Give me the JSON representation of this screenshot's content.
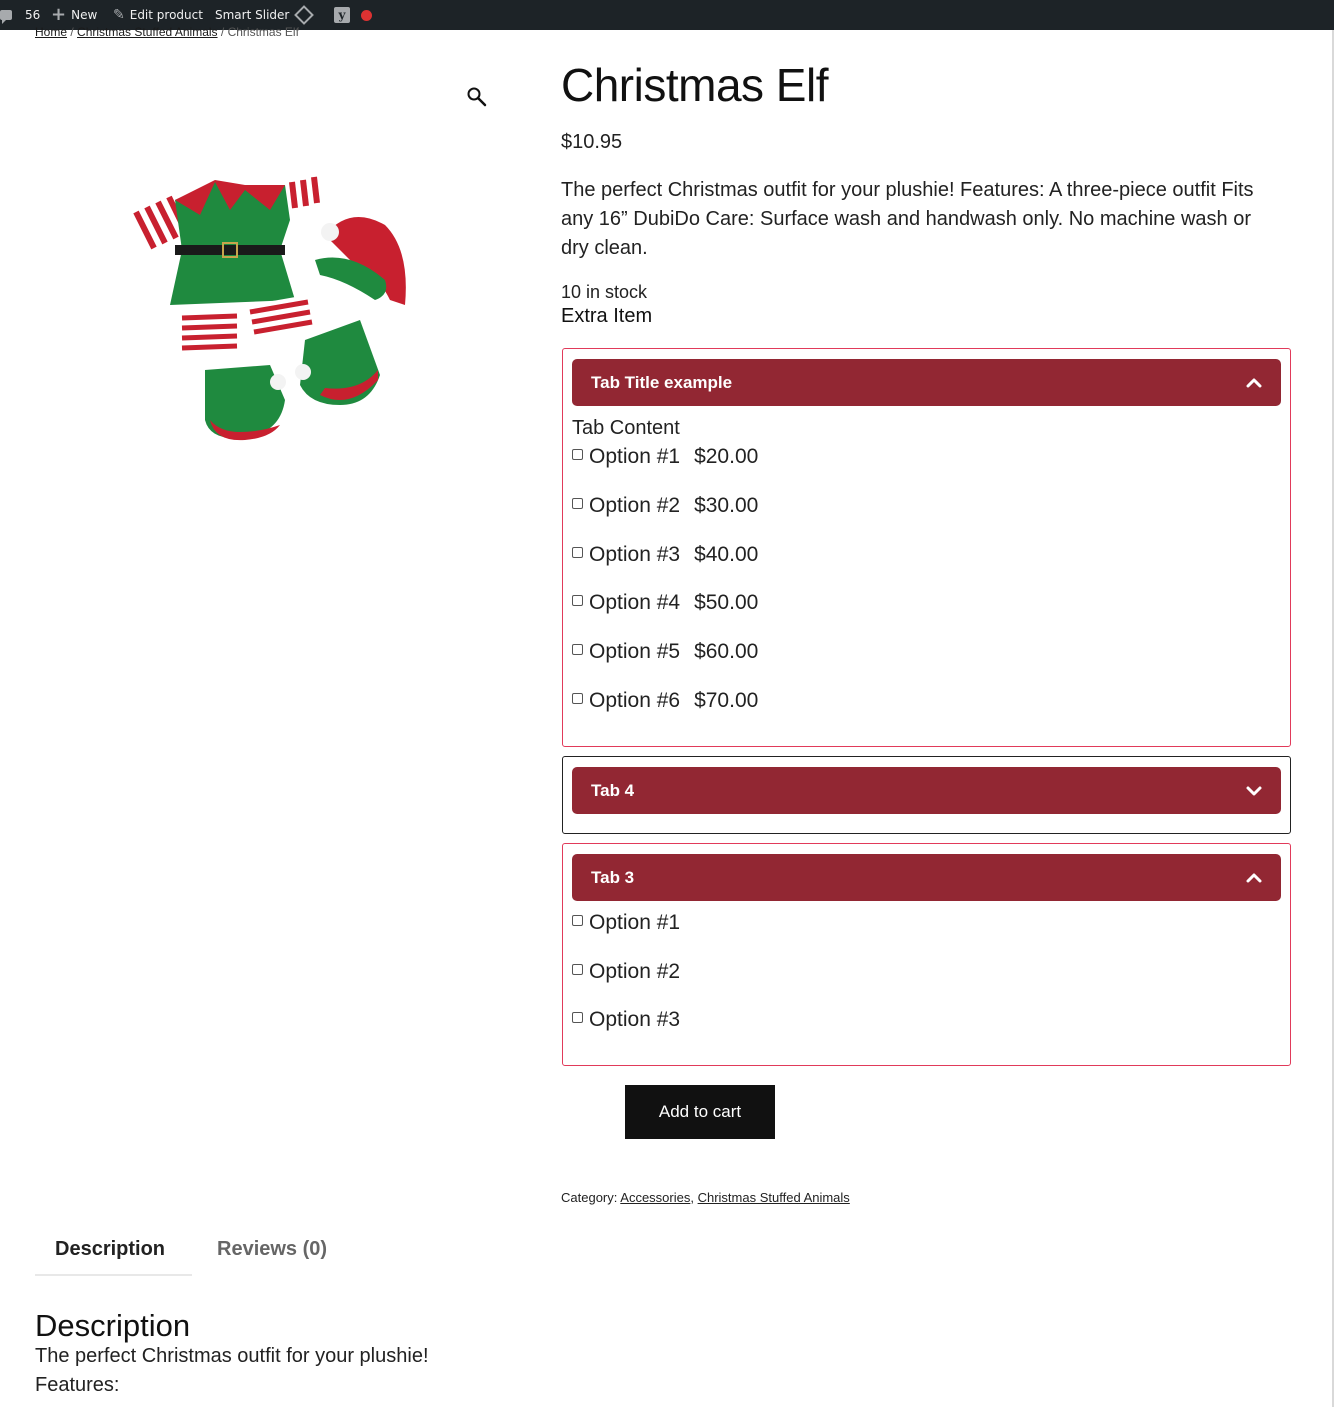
{
  "admin_bar": {
    "comments_count": "56",
    "new_label": "New",
    "edit_label": "Edit product",
    "slider_label": "Smart Slider",
    "yoast_label": "y"
  },
  "breadcrumb": {
    "home": "Home",
    "separator": " / ",
    "category": "Christmas Stuffed Animals",
    "current": "Christmas Elf"
  },
  "product": {
    "title": "Christmas Elf",
    "price": "$10.95",
    "short_description": "The perfect Christmas outfit for your plushie! Features: A three-piece outfit Fits any 16” DubiDo Care: Surface wash and handwash only. No machine wash or dry clean.",
    "stock": "10 in stock",
    "extra_item": "Extra Item"
  },
  "accordions": [
    {
      "title": "Tab Title example",
      "content_text": "Tab Content",
      "options": [
        {
          "label": "Option #1",
          "price": "$20.00"
        },
        {
          "label": "Option #2",
          "price": "$30.00"
        },
        {
          "label": "Option #3",
          "price": "$40.00"
        },
        {
          "label": "Option #4",
          "price": "$50.00"
        },
        {
          "label": "Option #5",
          "price": "$60.00"
        },
        {
          "label": "Option #6",
          "price": "$70.00"
        }
      ]
    },
    {
      "title": "Tab 4"
    },
    {
      "title": "Tab 3",
      "options": [
        {
          "label": "Option #1"
        },
        {
          "label": "Option #2"
        },
        {
          "label": "Option #3"
        }
      ]
    }
  ],
  "cart": {
    "button_label": "Add to cart"
  },
  "meta": {
    "category_label": "Category:",
    "categories": [
      "Accessories",
      "Christmas Stuffed Animals"
    ],
    "category_separator": ", "
  },
  "tabs": {
    "description": "Description",
    "reviews": "Reviews (0)"
  },
  "description_panel": {
    "heading": "Description",
    "line1": "The perfect Christmas outfit for your plushie!",
    "line2": "Features:"
  },
  "colors": {
    "accordion_header": "#922733",
    "accordion_border_open": "#e13a5a",
    "admin_bar": "#1d2327",
    "button": "#111111"
  }
}
